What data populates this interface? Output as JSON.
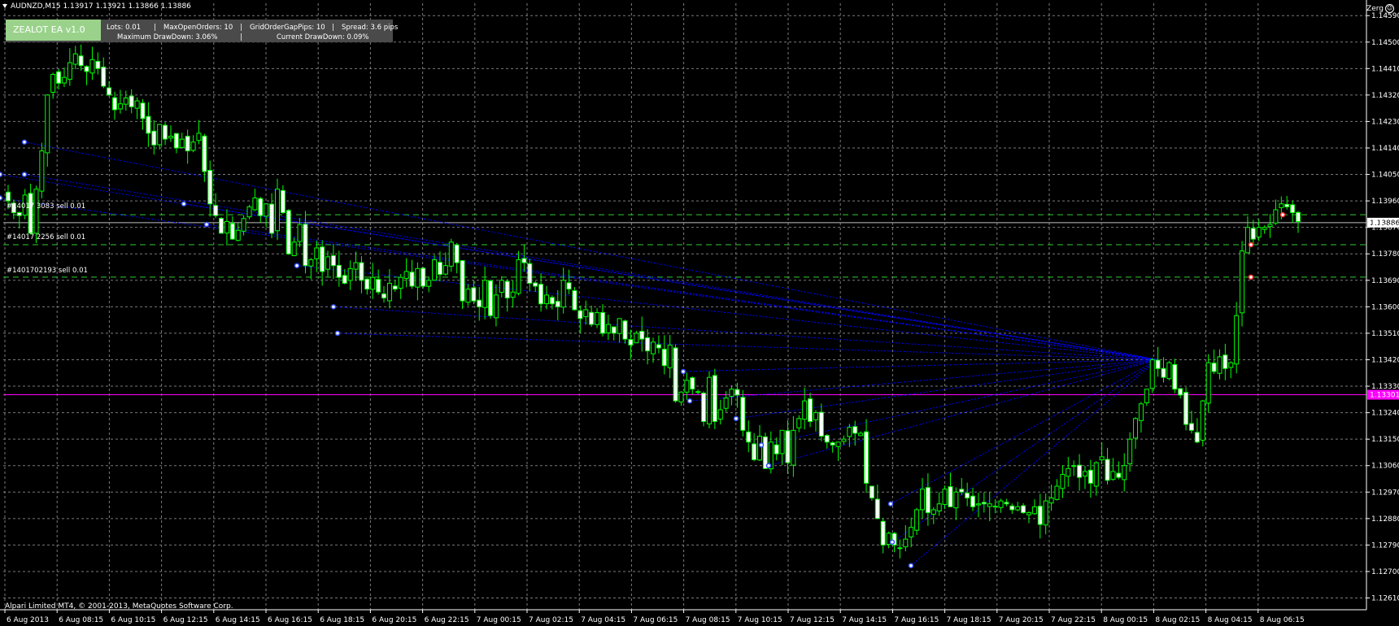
{
  "header": {
    "symbol_line": "AUDNZD,M15  1.13917 1.13921 1.13866 1.13886"
  },
  "ea_panel": {
    "name": "ZEALOT EA v1.0",
    "lots": "Lots: 0.01",
    "max_open_orders": "MaxOpenOrders: 10",
    "grid_gap": "GridOrderGapPips: 10",
    "spread": "Spread: 3.6 pips",
    "max_drawdown": "Maximum DrawDown: 3.06%",
    "current_drawdown": "Current DrawDown: 0.09%",
    "sep": "|"
  },
  "author": "Zerg",
  "copyright": "Alpari Limited MT4, © 2001-2013, MetaQuotes Software Corp.",
  "trade_labels": [
    "#14017 3083 sell 0.01",
    "#14017 2256 sell 0.01",
    "#1401702193 sell 0.01"
  ],
  "colors": {
    "bull": "#00ff00",
    "bear": "#ffffff",
    "grid": "#7a7a7a",
    "magenta": "#ff00ff",
    "order_line": "#0000ff",
    "trade_line": "#32cd32"
  },
  "chart_data": {
    "type": "candlestick",
    "symbol": "AUDNZD",
    "timeframe": "M15",
    "ylim": [
      1.1257,
      1.14632
    ],
    "y_ticks": [
      "1.14590",
      "1.14500",
      "1.14410",
      "1.14320",
      "1.14230",
      "1.14140",
      "1.14050",
      "1.13960",
      "1.13870",
      "1.13780",
      "1.13690",
      "1.13600",
      "1.13510",
      "1.13420",
      "1.13330",
      "1.13240",
      "1.13150",
      "1.13060",
      "1.12970",
      "1.12880",
      "1.12790",
      "1.12700",
      "1.12610"
    ],
    "x_ticks": [
      "6 Aug 2013",
      "6 Aug 08:15",
      "6 Aug 10:15",
      "6 Aug 12:15",
      "6 Aug 14:15",
      "6 Aug 16:15",
      "6 Aug 18:15",
      "6 Aug 20:15",
      "6 Aug 22:15",
      "7 Aug 00:15",
      "7 Aug 02:15",
      "7 Aug 04:15",
      "7 Aug 06:15",
      "7 Aug 08:15",
      "7 Aug 10:15",
      "7 Aug 12:15",
      "7 Aug 14:15",
      "7 Aug 16:15",
      "7 Aug 18:15",
      "7 Aug 20:15",
      "7 Aug 22:15",
      "8 Aug 00:15",
      "8 Aug 02:15",
      "8 Aug 04:15",
      "8 Aug 06:15"
    ],
    "current_price": "1.13886",
    "magenta_level": "1.13301",
    "trade_levels": [
      1.13913,
      1.13811,
      1.13701
    ],
    "grid": true,
    "closes": [
      1.1396,
      1.1392,
      1.1391,
      1.1398,
      1.1385,
      1.14,
      1.1413,
      1.1432,
      1.1439,
      1.1436,
      1.1438,
      1.1443,
      1.1446,
      1.1442,
      1.144,
      1.1444,
      1.1441,
      1.1435,
      1.1432,
      1.1427,
      1.1429,
      1.1431,
      1.1428,
      1.143,
      1.1424,
      1.1419,
      1.1415,
      1.1422,
      1.1417,
      1.1418,
      1.1414,
      1.1417,
      1.1413,
      1.1416,
      1.1419,
      1.1406,
      1.1395,
      1.1391,
      1.1385,
      1.1389,
      1.1383,
      1.1386,
      1.139,
      1.1394,
      1.1397,
      1.1391,
      1.1395,
      1.1385,
      1.14,
      1.1392,
      1.1378,
      1.1382,
      1.1388,
      1.1374,
      1.1376,
      1.138,
      1.1372,
      1.1377,
      1.1374,
      1.137,
      1.1368,
      1.1373,
      1.1375,
      1.1369,
      1.1366,
      1.137,
      1.1365,
      1.1363,
      1.1368,
      1.1366,
      1.137,
      1.1372,
      1.1367,
      1.1373,
      1.1367,
      1.1369,
      1.1376,
      1.1371,
      1.1374,
      1.1382,
      1.1375,
      1.1362,
      1.1366,
      1.1362,
      1.136,
      1.1369,
      1.1357,
      1.1364,
      1.1369,
      1.1363,
      1.1365,
      1.1376,
      1.1375,
      1.1368,
      1.1367,
      1.1361,
      1.1364,
      1.1361,
      1.136,
      1.1369,
      1.1366,
      1.1359,
      1.1356,
      1.1359,
      1.1354,
      1.1358,
      1.1351,
      1.1354,
      1.1351,
      1.1356,
      1.1349,
      1.1347,
      1.1351,
      1.1349,
      1.1345,
      1.1348,
      1.1346,
      1.134,
      1.1347,
      1.1328,
      1.1331,
      1.1335,
      1.1332,
      1.1331,
      1.1321,
      1.1336,
      1.1321,
      1.1325,
      1.1329,
      1.1332,
      1.133,
      1.1318,
      1.1314,
      1.1308,
      1.1316,
      1.1305,
      1.1314,
      1.131,
      1.1318,
      1.1307,
      1.1318,
      1.1322,
      1.1328,
      1.1321,
      1.1324,
      1.1316,
      1.1314,
      1.1313,
      1.1314,
      1.1315,
      1.1319,
      1.1317,
      1.1317,
      1.13,
      1.1295,
      1.1288,
      1.1279,
      1.1283,
      1.1279,
      1.1278,
      1.1281,
      1.1285,
      1.1291,
      1.1298,
      1.129,
      1.1291,
      1.1293,
      1.1298,
      1.1292,
      1.1297,
      1.1297,
      1.1295,
      1.1292,
      1.1293,
      1.1293,
      1.1293,
      1.1292,
      1.1294,
      1.1293,
      1.1291,
      1.1292,
      1.129,
      1.129,
      1.1292,
      1.1286,
      1.1294,
      1.1295,
      1.1299,
      1.1303,
      1.1305,
      1.1306,
      1.1302,
      1.1304,
      1.13,
      1.1307,
      1.1309,
      1.1301,
      1.1304,
      1.1302,
      1.1306,
      1.1315,
      1.1322,
      1.1327,
      1.1332,
      1.1342,
      1.1339,
      1.1336,
      1.1341,
      1.1332,
      1.133,
      1.132,
      1.1318,
      1.1314,
      1.1328,
      1.1341,
      1.1338,
      1.1343,
      1.1339,
      1.1341,
      1.1357,
      1.1379,
      1.1387,
      1.1383,
      1.1387,
      1.1387,
      1.1388,
      1.1393,
      1.1395,
      1.1394,
      1.1392,
      1.1389
    ]
  }
}
